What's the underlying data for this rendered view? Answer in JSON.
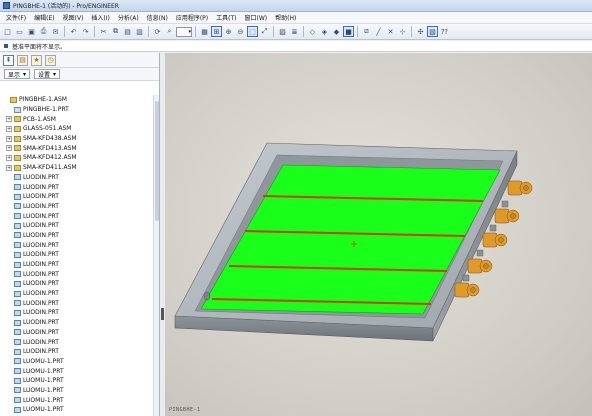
{
  "window": {
    "title": "PINGBHE-1 (活动的) - Pro/ENGINEER"
  },
  "menu": [
    "文件(F)",
    "编辑(E)",
    "视图(V)",
    "插入(I)",
    "分析(A)",
    "信息(N)",
    "应用程序(P)",
    "工具(T)",
    "窗口(W)",
    "帮助(H)"
  ],
  "message": "基准平面将不显示。",
  "navigator": {
    "show_dropdown": "显示",
    "settings_dropdown": "设置",
    "tree": [
      {
        "label": "PINGBHE-1.ASM",
        "type": "asm",
        "expand": "",
        "level": 0
      },
      {
        "label": "PINGBHE-1.PRT",
        "type": "prt",
        "expand": "",
        "level": 1
      },
      {
        "label": "PCB-1.ASM",
        "type": "asm",
        "expand": "+",
        "level": 1
      },
      {
        "label": "GLASS-051.ASM",
        "type": "asm",
        "expand": "+",
        "level": 1
      },
      {
        "label": "SMA-KFD438.ASM",
        "type": "asm",
        "expand": "+",
        "level": 1
      },
      {
        "label": "SMA-KFD413.ASM",
        "type": "asm",
        "expand": "+",
        "level": 1
      },
      {
        "label": "SMA-KFD412.ASM",
        "type": "asm",
        "expand": "+",
        "level": 1
      },
      {
        "label": "SMA-KFD411.ASM",
        "type": "asm",
        "expand": "+",
        "level": 1
      },
      {
        "label": "LUODIN.PRT",
        "type": "prt-sub",
        "expand": "",
        "level": 1
      },
      {
        "label": "LUODIN.PRT",
        "type": "prt-sub",
        "expand": "",
        "level": 1
      },
      {
        "label": "LUODIN.PRT",
        "type": "prt-sub",
        "expand": "",
        "level": 1
      },
      {
        "label": "LUODIN.PRT",
        "type": "prt-sub",
        "expand": "",
        "level": 1
      },
      {
        "label": "LUODIN.PRT",
        "type": "prt-sub",
        "expand": "",
        "level": 1
      },
      {
        "label": "LUODIN.PRT",
        "type": "prt-sub",
        "expand": "",
        "level": 1
      },
      {
        "label": "LUODIN.PRT",
        "type": "prt-sub",
        "expand": "",
        "level": 1
      },
      {
        "label": "LUODIN.PRT",
        "type": "prt-sub",
        "expand": "",
        "level": 1
      },
      {
        "label": "LUODIN.PRT",
        "type": "prt-sub",
        "expand": "",
        "level": 1
      },
      {
        "label": "LUODIN.PRT",
        "type": "prt-sub",
        "expand": "",
        "level": 1
      },
      {
        "label": "LUODIN.PRT",
        "type": "prt-sub",
        "expand": "",
        "level": 1
      },
      {
        "label": "LUODIN.PRT",
        "type": "prt-sub",
        "expand": "",
        "level": 1
      },
      {
        "label": "LUODIN.PRT",
        "type": "prt-sub",
        "expand": "",
        "level": 1
      },
      {
        "label": "LUODIN.PRT",
        "type": "prt-sub",
        "expand": "",
        "level": 1
      },
      {
        "label": "LUODIN.PRT",
        "type": "prt-sub",
        "expand": "",
        "level": 1
      },
      {
        "label": "LUODIN.PRT",
        "type": "prt-sub",
        "expand": "",
        "level": 1
      },
      {
        "label": "LUODIN.PRT",
        "type": "prt-sub",
        "expand": "",
        "level": 1
      },
      {
        "label": "LUODIN.PRT",
        "type": "prt-sub",
        "expand": "",
        "level": 1
      },
      {
        "label": "LUODIN.PRT",
        "type": "prt-sub",
        "expand": "",
        "level": 1
      },
      {
        "label": "LUOMU-1.PRT",
        "type": "prt-sub",
        "expand": "",
        "level": 1
      },
      {
        "label": "LUOMU-1.PRT",
        "type": "prt-sub",
        "expand": "",
        "level": 1
      },
      {
        "label": "LUOMU-1.PRT",
        "type": "prt-sub",
        "expand": "",
        "level": 1
      },
      {
        "label": "LUOMU-1.PRT",
        "type": "prt-sub",
        "expand": "",
        "level": 1
      },
      {
        "label": "LUOMU-1.PRT",
        "type": "prt-sub",
        "expand": "",
        "level": 1
      },
      {
        "label": "LUOMU-1.PRT",
        "type": "prt-sub",
        "expand": "",
        "level": 1
      },
      {
        "label": "LUOMU-1.PRT",
        "type": "prt-sub",
        "expand": "",
        "level": 1
      }
    ]
  },
  "toolbar_icons": [
    "new-icon",
    "open-icon",
    "save-icon",
    "print-icon",
    "email-icon",
    "sep",
    "undo-icon",
    "redo-icon",
    "sep",
    "cut-icon",
    "copy-icon",
    "paste-icon",
    "paste-special-icon",
    "sep",
    "regenerate-icon",
    "find-icon",
    "select-combo",
    "sep",
    "repaint-icon",
    "orient-icon",
    "zoom-in-icon",
    "zoom-out-icon",
    "refit-icon",
    "reorient-icon",
    "sep",
    "view-manager-icon",
    "layers-icon",
    "sep",
    "wireframe-icon",
    "hidden-line-icon",
    "no-hidden-icon",
    "shading-icon",
    "sep",
    "datum-planes-icon",
    "datum-axes-icon",
    "datum-points-icon",
    "coord-sys-icon",
    "sep",
    "spin-center-icon",
    "annotations-icon",
    "help-icon"
  ],
  "active_toolbar_icons": [
    "orient-icon",
    "refit-icon",
    "shading-icon",
    "annotations-icon"
  ],
  "viewport": {
    "model_label": "PINGBHE-1"
  },
  "colors": {
    "board": "#19ff19",
    "trace": "#d43a12",
    "housing": "#a6adb3",
    "connector": "#e09a2a"
  }
}
